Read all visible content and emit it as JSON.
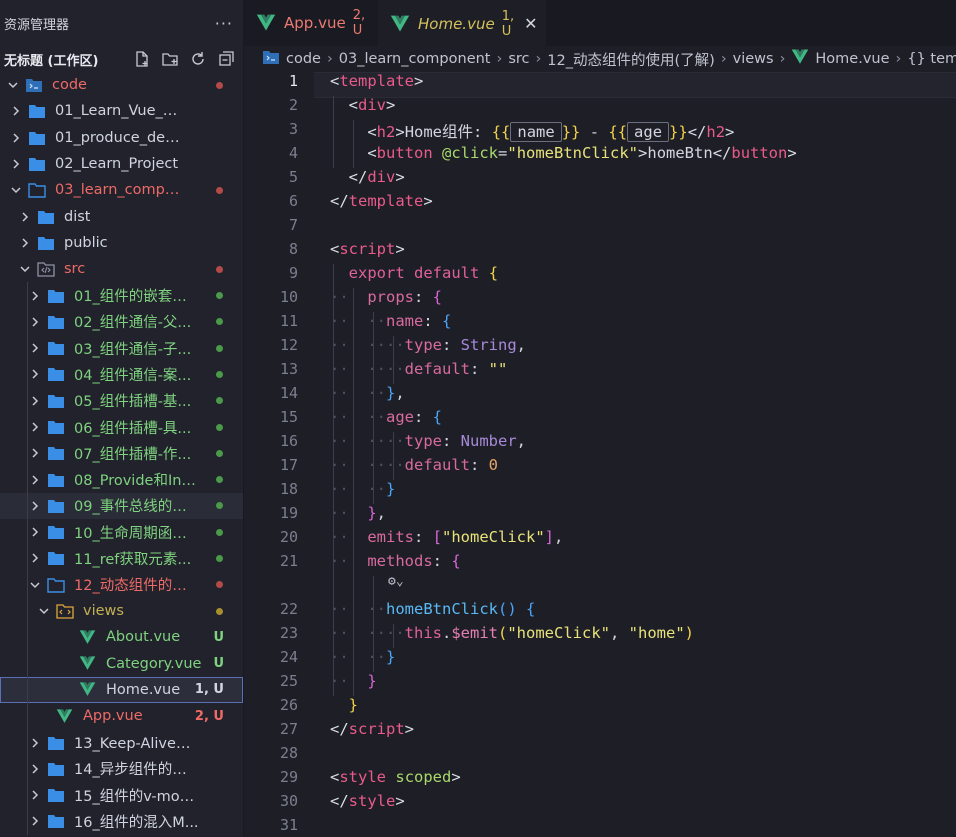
{
  "sidebar": {
    "title": "资源管理器",
    "more": "···",
    "workspace": "无标题 (工作区)",
    "items": [
      {
        "label": "code",
        "depth": 0,
        "open": true,
        "icon": "vscode-folder-icon",
        "color": "red",
        "mark": "dot"
      },
      {
        "label": "01_Learn_Vue_Basic",
        "depth": 1,
        "open": false,
        "icon": "folder-icon",
        "color": "plain"
      },
      {
        "label": "01_produce_demoo",
        "depth": 1,
        "open": false,
        "icon": "folder-icon",
        "color": "plain"
      },
      {
        "label": "02_Learn_Project",
        "depth": 1,
        "open": false,
        "icon": "folder-icon",
        "color": "plain"
      },
      {
        "label": "03_learn_component",
        "depth": 1,
        "open": true,
        "icon": "folder-open-icon",
        "color": "red",
        "mark": "dot"
      },
      {
        "label": "dist",
        "depth": 2,
        "open": false,
        "icon": "folder-icon",
        "color": "plain"
      },
      {
        "label": "public",
        "depth": 2,
        "open": false,
        "icon": "folder-icon",
        "color": "plain"
      },
      {
        "label": "src",
        "depth": 2,
        "open": true,
        "icon": "src-folder-icon",
        "color": "red",
        "mark": "dot"
      },
      {
        "label": "01_组件的嵌套使...",
        "depth": 3,
        "open": false,
        "icon": "folder-icon",
        "color": "green",
        "mark": "dot"
      },
      {
        "label": "02_组件通信-父...",
        "depth": 3,
        "open": false,
        "icon": "folder-icon",
        "color": "green",
        "mark": "dot"
      },
      {
        "label": "03_组件通信-子...",
        "depth": 3,
        "open": false,
        "icon": "folder-icon",
        "color": "green",
        "mark": "dot"
      },
      {
        "label": "04_组件通信-案...",
        "depth": 3,
        "open": false,
        "icon": "folder-icon",
        "color": "green",
        "mark": "dot"
      },
      {
        "label": "05_组件插槽-基...",
        "depth": 3,
        "open": false,
        "icon": "folder-icon",
        "color": "green",
        "mark": "dot"
      },
      {
        "label": "06_组件插槽-具...",
        "depth": 3,
        "open": false,
        "icon": "folder-icon",
        "color": "green",
        "mark": "dot"
      },
      {
        "label": "07_组件插槽-作...",
        "depth": 3,
        "open": false,
        "icon": "folder-icon",
        "color": "green",
        "mark": "dot"
      },
      {
        "label": "08_Provide和Inje...",
        "depth": 3,
        "open": false,
        "icon": "folder-icon",
        "color": "green",
        "mark": "dot"
      },
      {
        "label": "09_事件总线的使...",
        "depth": 3,
        "open": false,
        "icon": "folder-icon",
        "color": "green",
        "mark": "dot",
        "hover": true
      },
      {
        "label": "10_生命周期函数...",
        "depth": 3,
        "open": false,
        "icon": "folder-icon",
        "color": "green",
        "mark": "dot"
      },
      {
        "label": "11_ref获取元素...",
        "depth": 3,
        "open": false,
        "icon": "folder-icon",
        "color": "green",
        "mark": "dot"
      },
      {
        "label": "12_动态组件的使...",
        "depth": 3,
        "open": true,
        "icon": "folder-open-icon",
        "color": "red",
        "mark": "dot"
      },
      {
        "label": "views",
        "depth": 4,
        "open": true,
        "icon": "views-folder-icon",
        "color": "olive",
        "mark": "dot-olive"
      },
      {
        "label": "About.vue",
        "depth": 5,
        "icon": "vue-file-icon",
        "color": "green",
        "badge": "U"
      },
      {
        "label": "Category.vue",
        "depth": 5,
        "icon": "vue-file-icon",
        "color": "green",
        "badge": "U"
      },
      {
        "label": "Home.vue",
        "depth": 5,
        "icon": "vue-file-icon",
        "color": "plain",
        "badge": "1, U",
        "selected": true
      },
      {
        "label": "App.vue",
        "depth": 4,
        "icon": "vue-file-icon",
        "color": "red",
        "badge": "2, U"
      },
      {
        "label": "13_Keep-Alive的...",
        "depth": 3,
        "open": false,
        "icon": "folder-icon",
        "color": "plain"
      },
      {
        "label": "14_异步组件的使...",
        "depth": 3,
        "open": false,
        "icon": "folder-icon",
        "color": "plain"
      },
      {
        "label": "15_组件的v-mod...",
        "depth": 3,
        "open": false,
        "icon": "folder-icon",
        "color": "plain"
      },
      {
        "label": "16_组件的混入M...",
        "depth": 3,
        "open": false,
        "icon": "folder-icon",
        "color": "plain"
      }
    ]
  },
  "tabs": [
    {
      "name": "App.vue",
      "status": "2, U",
      "active": false
    },
    {
      "name": "Home.vue",
      "status": "1, U",
      "active": true
    }
  ],
  "breadcrumb": [
    "code",
    "03_learn_component",
    "src",
    "12_动态组件的使用(了解)",
    "views",
    "Home.vue",
    "{} tem"
  ],
  "editor": {
    "current_line": 1,
    "line_numbers": [
      "1",
      "2",
      "3",
      "4",
      "5",
      "6",
      "7",
      "8",
      "9",
      "10",
      "11",
      "12",
      "13",
      "14",
      "15",
      "16",
      "17",
      "18",
      "19",
      "20",
      "21",
      "",
      "22",
      "23",
      "24",
      "25",
      "26",
      "27",
      "28",
      "29",
      "30",
      "31"
    ]
  },
  "colors": {
    "accent_red": "#ee6a66",
    "accent_green": "#7fd27f",
    "accent_olive": "#c2b052",
    "vue_green": "#41b883"
  }
}
